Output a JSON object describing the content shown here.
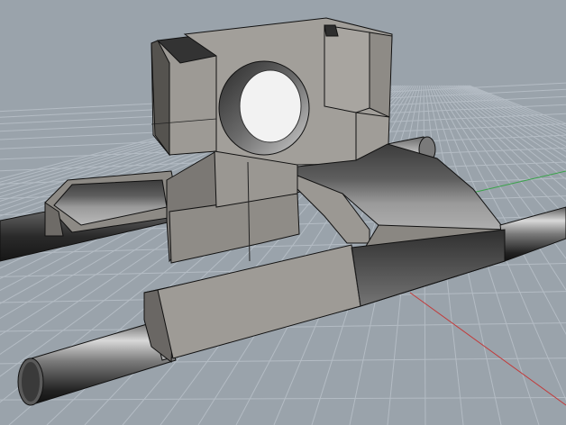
{
  "viewport": {
    "type": "3D CAD perspective viewport (shaded)",
    "colors": {
      "background": "#9aa3ab",
      "grid_line": "#b6bec6",
      "grid_major": "#c3cad1",
      "axis_x": "#c23a3a",
      "axis_y": "#3aa34a",
      "part_face_light": "#a5a29d",
      "part_face_mid": "#8e8b86",
      "part_face_dark": "#4e4c49",
      "edge": "#1a1a1a",
      "rod_light": "#d8d8d8",
      "rod_dark": "#1e1e1e"
    }
  },
  "objects": [
    {
      "name": "back-rod",
      "kind": "cylinder"
    },
    {
      "name": "front-rod",
      "kind": "cylinder"
    },
    {
      "name": "bearing-block-upper",
      "kind": "solid",
      "feature": "through-hole"
    },
    {
      "name": "rod-clamp-left",
      "kind": "solid"
    },
    {
      "name": "rod-clamp-front",
      "kind": "solid"
    }
  ]
}
